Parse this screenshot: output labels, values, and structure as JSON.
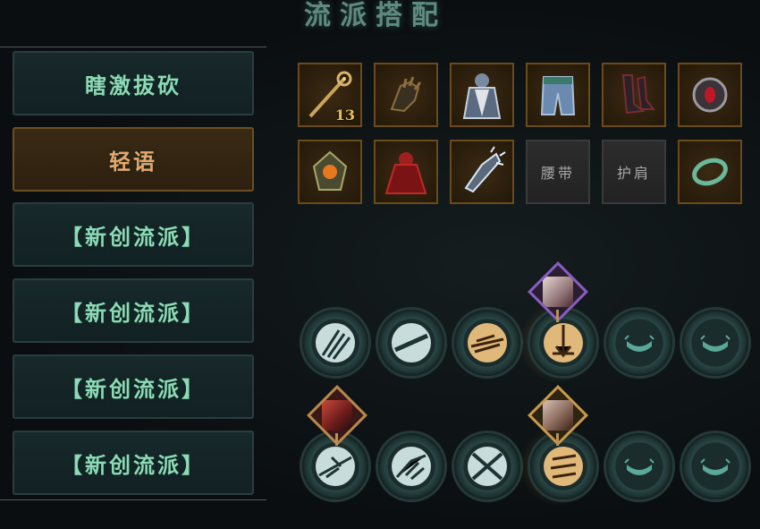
{
  "title": "流派搭配",
  "presets": [
    {
      "label": "瞎激拔砍",
      "active": false
    },
    {
      "label": "轻语",
      "active": true
    },
    {
      "label": "【新创流派】",
      "active": false
    },
    {
      "label": "【新创流派】",
      "active": false
    },
    {
      "label": "【新创流派】",
      "active": false
    },
    {
      "label": "【新创流派】",
      "active": false
    }
  ],
  "equipment": {
    "row1": [
      {
        "icon": "staff-weapon-icon",
        "badge": "13"
      },
      {
        "icon": "gauntlet-icon"
      },
      {
        "icon": "cloak-armor-icon"
      },
      {
        "icon": "leggings-icon"
      },
      {
        "icon": "boots-icon"
      },
      {
        "icon": "red-gem-amulet-icon"
      }
    ],
    "row2": [
      {
        "icon": "orange-gem-charm-icon"
      },
      {
        "icon": "red-cape-icon"
      },
      {
        "icon": "ice-gauntlet-icon"
      },
      {
        "label": "腰带",
        "empty": true
      },
      {
        "label": "护肩",
        "empty": true
      },
      {
        "icon": "green-ring-icon"
      }
    ]
  },
  "skills": {
    "row1": [
      "claw-slash-skill-icon",
      "blade-swipe-skill-icon",
      "dash-strike-skill-icon",
      "burst-skill-icon",
      "empty-slot-icon",
      "empty-slot-icon"
    ],
    "row2": [
      "spear-thrust-skill-icon",
      "wing-slash-skill-icon",
      "cross-blades-skill-icon",
      "triple-slash-skill-icon",
      "empty-slot-icon",
      "empty-slot-icon"
    ]
  },
  "colors": {
    "accent_green": "#8ed9b8",
    "active_orange": "#e9a56a",
    "gold_border": "#6b4a1c"
  }
}
